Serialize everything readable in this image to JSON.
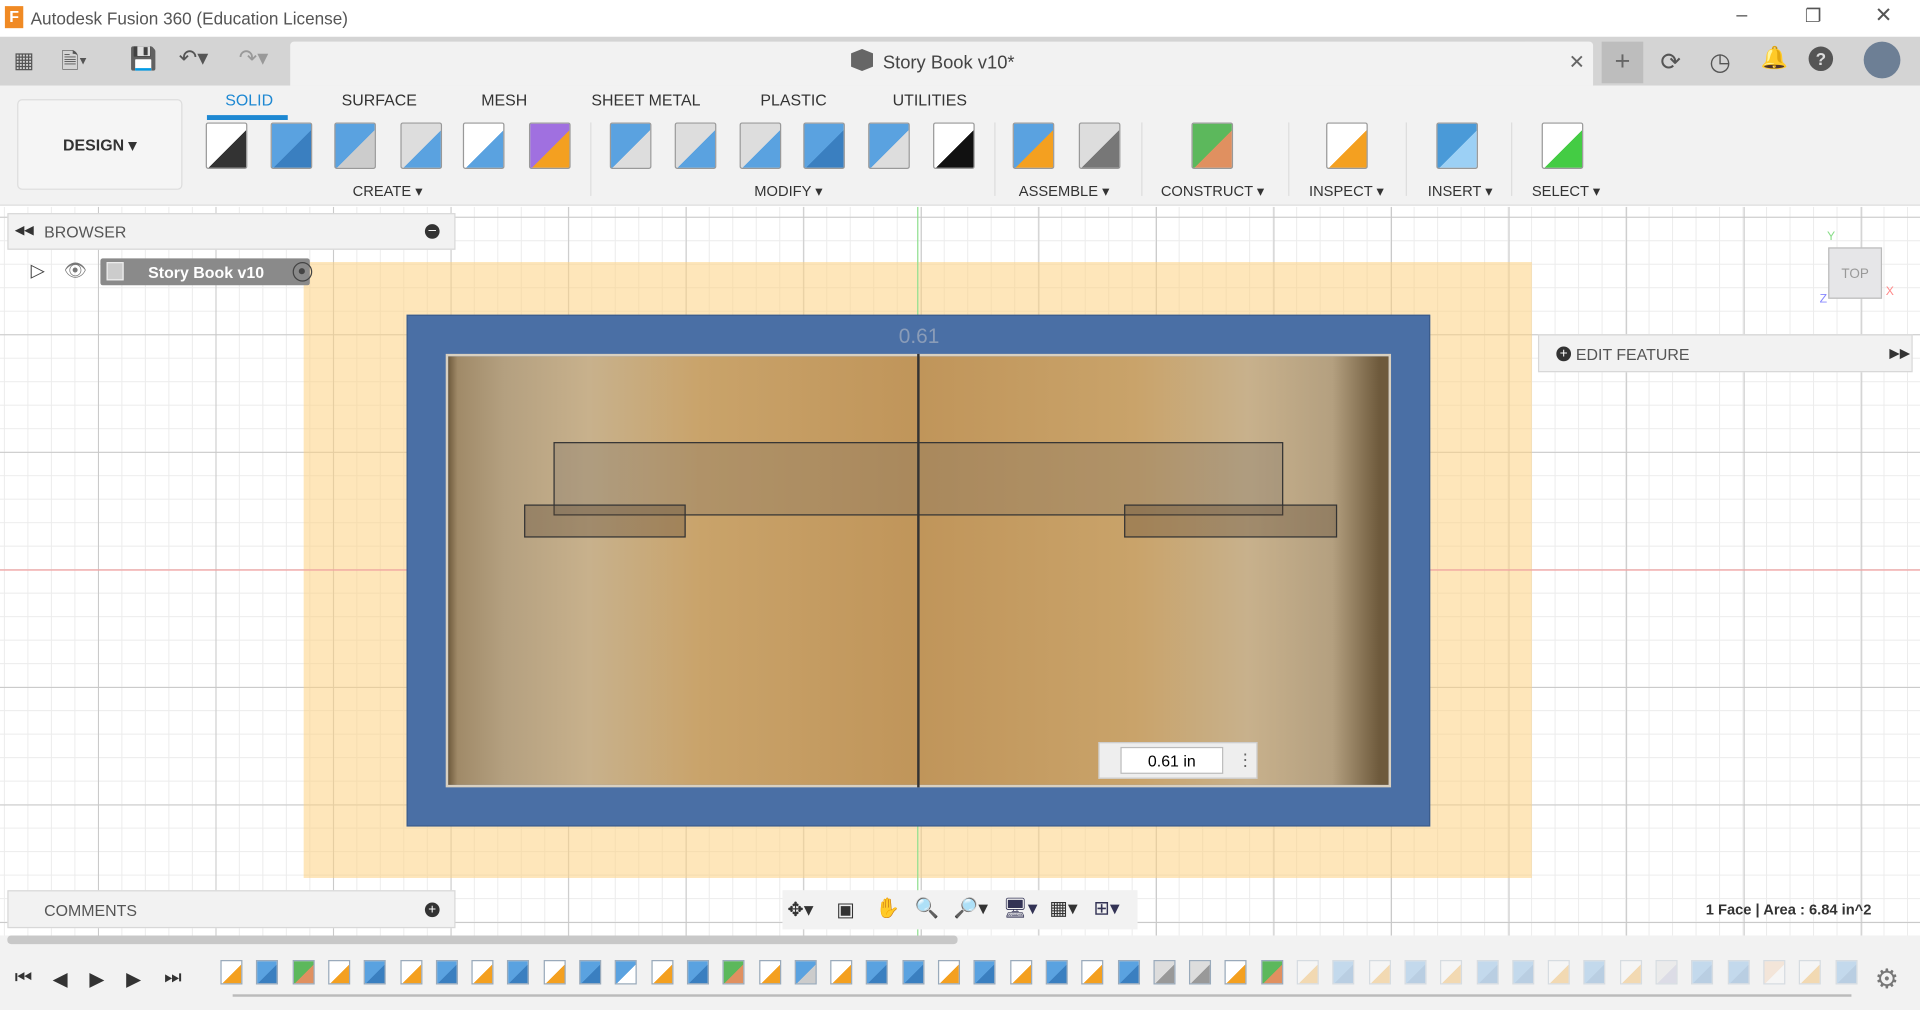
{
  "app": {
    "title": "Autodesk Fusion 360 (Education License)",
    "logo": "F"
  },
  "window_controls": [
    "minimize-icon",
    "restore-icon",
    "close-icon"
  ],
  "document": {
    "title": "Story Book v10*"
  },
  "topbar_icons": [
    "grid-apps-icon",
    "file-icon",
    "save-icon",
    "undo-icon",
    "redo-icon"
  ],
  "topbar_right_icons": [
    "plus-icon",
    "extensions-icon",
    "job-status-icon",
    "bell-icon",
    "help-icon",
    "avatar"
  ],
  "workspace": {
    "label": "DESIGN"
  },
  "tabs": [
    {
      "label": "SOLID",
      "active": true
    },
    {
      "label": "SURFACE"
    },
    {
      "label": "MESH"
    },
    {
      "label": "SHEET METAL"
    },
    {
      "label": "PLASTIC"
    },
    {
      "label": "UTILITIES"
    }
  ],
  "groups": [
    {
      "label": "CREATE"
    },
    {
      "label": "MODIFY"
    },
    {
      "label": "ASSEMBLE"
    },
    {
      "label": "CONSTRUCT"
    },
    {
      "label": "INSPECT"
    },
    {
      "label": "INSERT"
    },
    {
      "label": "SELECT"
    }
  ],
  "browser": {
    "title": "BROWSER",
    "root": "Story Book v10"
  },
  "comments": {
    "title": "COMMENTS"
  },
  "edit_feature": {
    "label": "EDIT FEATURE"
  },
  "viewcube": {
    "face": "TOP",
    "x": "X",
    "y": "Y",
    "z": "Z"
  },
  "dimension": {
    "label": "0.61",
    "input_value": "0.61 in"
  },
  "status": {
    "selection": "1 Face | Area : 6.84 in^2"
  },
  "colors": {
    "accent": "#1e88d2",
    "sketch_plane": "#fde3b0",
    "body": "#4a6fa5",
    "face": "#c9a36a"
  },
  "timeline": {
    "items": [
      "sketch",
      "extrude",
      "plane",
      "sketch",
      "extrude",
      "sketch",
      "extrude",
      "sketch",
      "extrude",
      "sketch",
      "extrude",
      "mirror",
      "sketch",
      "extrude",
      "plane",
      "sketch",
      "revolve",
      "sketch",
      "extrude",
      "extrude",
      "sketch",
      "extrude",
      "sketch",
      "extrude",
      "sketch",
      "extrude",
      "fillet",
      "fillet",
      "sketch",
      "plane",
      "sketch-s",
      "extrude-s",
      "sketch-s",
      "extrude-s",
      "sketch-s",
      "extrude-s",
      "extrude-s",
      "sketch-s",
      "extrude-s",
      "sketch-s",
      "joint-s",
      "extrude-s",
      "extrude-s",
      "chamfer-s",
      "sketch-s",
      "extrude-s"
    ]
  }
}
